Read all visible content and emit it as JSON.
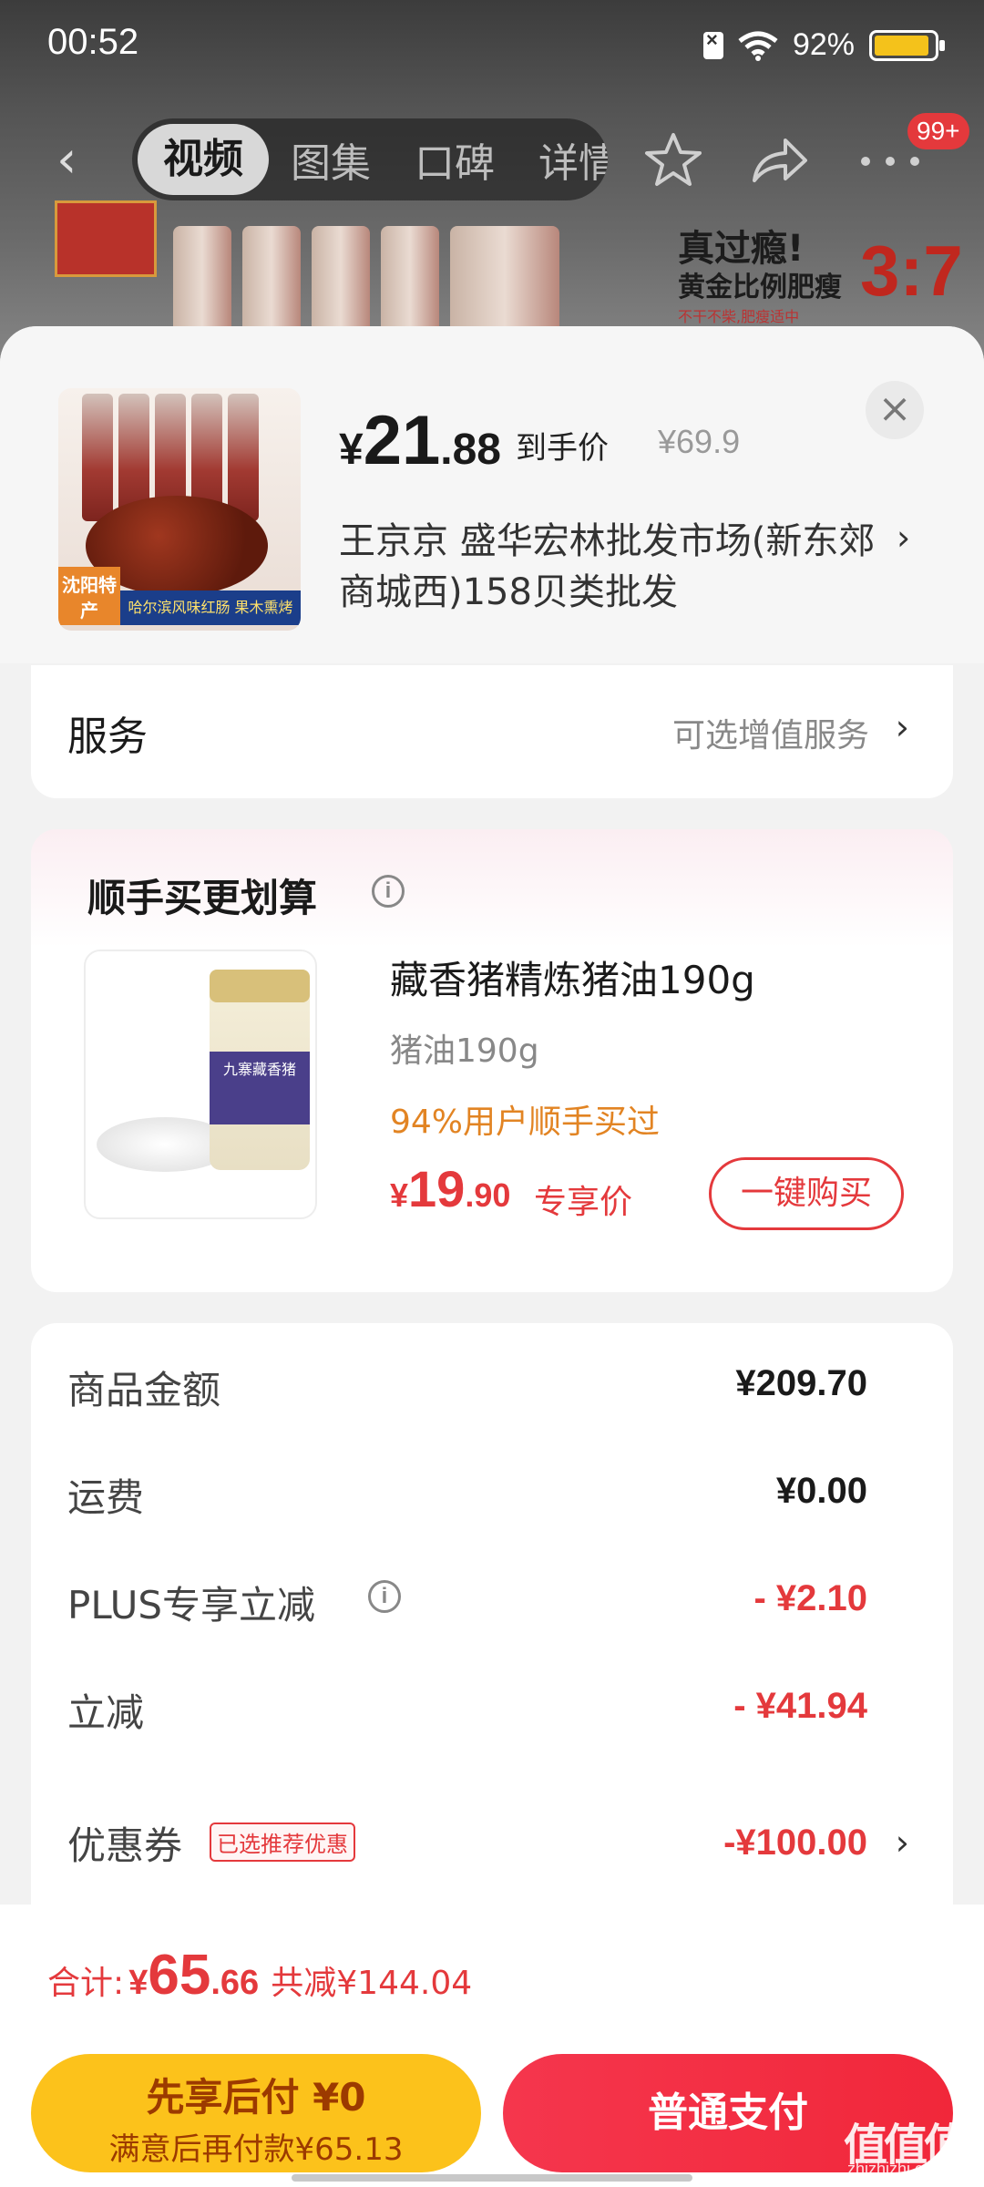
{
  "status_bar": {
    "time": "00:52",
    "battery": "92%",
    "icons": [
      "sim-off-icon",
      "wifi-icon",
      "battery-icon"
    ]
  },
  "nav": {
    "back_icon": "back-icon",
    "tabs": [
      {
        "label": "视频",
        "active": true
      },
      {
        "label": "图集",
        "active": false
      },
      {
        "label": "口碑",
        "active": false
      },
      {
        "label": "详情",
        "active": false
      }
    ],
    "icons": [
      "star-icon",
      "share-icon",
      "more-icon"
    ],
    "badge": "99+"
  },
  "banner": {
    "text1": "真过瘾!",
    "text2": "黄金比例肥瘦",
    "ratio": "3:7",
    "small": "不干不柴,肥瘦适中"
  },
  "product": {
    "thumb_tag": "沈阳特产",
    "thumb_strip": "哈尔滨风味红肠 果木熏烤",
    "price_currency": "¥",
    "price_int": "21",
    "price_dec": ".88",
    "price_label": "到手价",
    "original_price": "¥69.9",
    "shop": "王京京  盛华宏林批发市场(新东郊商城西)158贝类批发"
  },
  "service": {
    "title": "服务",
    "value": "可选增值服务"
  },
  "addon": {
    "title": "顺手买更划算",
    "name": "藏香猪精炼猪油190g",
    "spec": "猪油190g",
    "stat": "94%用户顺手买过",
    "price_currency": "¥",
    "price_int": "19",
    "price_dec": ".90",
    "price_label": "专享价",
    "buy_label": "一键购买",
    "jar_label": "九寨藏香猪"
  },
  "summary": {
    "rows": [
      {
        "label": "商品金额",
        "value": "¥209.70",
        "red": false
      },
      {
        "label": "运费",
        "value": "¥0.00",
        "red": false
      },
      {
        "label": "PLUS专享立减",
        "value": "- ¥2.10",
        "red": true
      },
      {
        "label": "立减",
        "value": "- ¥41.94",
        "red": true
      },
      {
        "label": "优惠券",
        "value": "-¥100.00",
        "red": true
      }
    ],
    "coupon_tag": "已选推荐优惠"
  },
  "total": {
    "label": "合计:",
    "currency": "¥",
    "int": "65",
    "dec": ".66",
    "saved": "共减¥144.04"
  },
  "buttons": {
    "later_line1": "先享后付 ¥0",
    "later_line2": "满意后再付款¥65.13",
    "pay": "普通支付"
  },
  "watermark": {
    "main": "值值值",
    "sub": "zhizhizhi.com"
  },
  "colors": {
    "accent_red": "#e4393c",
    "later_yellow": "#fcc21b",
    "stat_orange": "#e28423"
  }
}
